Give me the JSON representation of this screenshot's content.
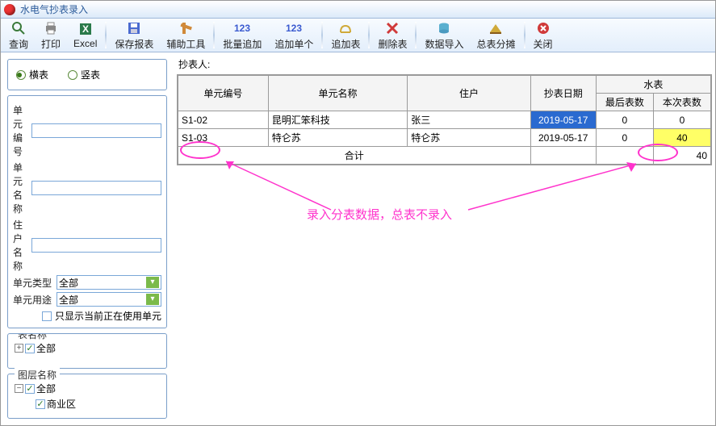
{
  "title": "水电气抄表录入",
  "toolbar": [
    {
      "id": "query",
      "label": "查询"
    },
    {
      "id": "print",
      "label": "打印"
    },
    {
      "id": "excel",
      "label": "Excel"
    },
    {
      "id": "sep"
    },
    {
      "id": "save",
      "label": "保存报表"
    },
    {
      "id": "assist",
      "label": "辅助工具"
    },
    {
      "id": "sep"
    },
    {
      "id": "batchadd",
      "label": "批量追加"
    },
    {
      "id": "addsingle",
      "label": "追加单个"
    },
    {
      "id": "sep"
    },
    {
      "id": "addmeter",
      "label": "追加表"
    },
    {
      "id": "sep"
    },
    {
      "id": "delmeter",
      "label": "删除表"
    },
    {
      "id": "sep"
    },
    {
      "id": "import",
      "label": "数据导入"
    },
    {
      "id": "split",
      "label": "总表分摊"
    },
    {
      "id": "sep"
    },
    {
      "id": "close",
      "label": "关闭"
    }
  ],
  "orient": {
    "horiz": "横表",
    "vert": "竖表",
    "selected": "horiz"
  },
  "filters": {
    "unitno_label": "单元编号",
    "unitno": "",
    "unitname_label": "单元名称",
    "unitname": "",
    "resident_label": "住户名称",
    "resident": "",
    "unittype_label": "单元类型",
    "unittype": "全部",
    "unituse_label": "单元用途",
    "unituse": "全部",
    "onlyactive_label": "只显示当前正在使用单元",
    "onlyactive": false
  },
  "metername_label": "表名称",
  "meter_tree": [
    {
      "label": "全部",
      "checked": true
    }
  ],
  "layer_label": "图层名称",
  "layer_tree": [
    {
      "label": "全部",
      "checked": true,
      "children": [
        {
          "label": "商业区",
          "checked": true
        }
      ]
    }
  ],
  "reader_label": "抄表人:",
  "table": {
    "headers": {
      "unitno": "单元编号",
      "unitname": "单元名称",
      "resident": "住户",
      "date": "抄表日期",
      "water": "水表",
      "last": "最后表数",
      "current": "本次表数",
      "total": "合计"
    },
    "rows": [
      {
        "unitno": "S1-02",
        "unitname": "昆明汇笨科技",
        "resident": "张三",
        "date": "2019-05-17",
        "last": "0",
        "current": "0",
        "sel": true
      },
      {
        "unitno": "S1-03",
        "unitname": "特仑苏",
        "resident": "特仑苏",
        "date": "2019-05-17",
        "last": "0",
        "current": "40",
        "hl": true
      }
    ],
    "total_current": "40"
  },
  "annotation": "录入分表数据，总表不录入"
}
